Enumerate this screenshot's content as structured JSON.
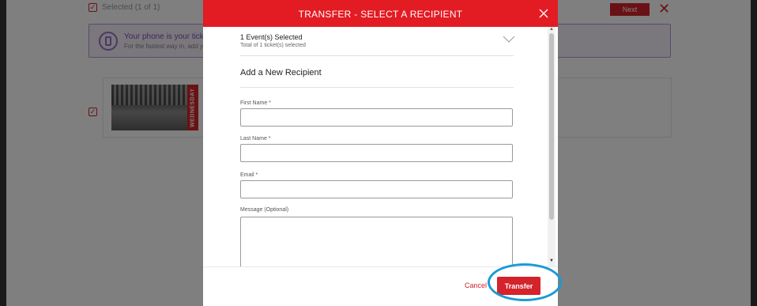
{
  "background": {
    "selected_text": "Selected (1 of 1)",
    "next_label": "Next",
    "banner": {
      "title": "Your phone is your ticket.",
      "subtitle": "For the fastest way in, add your"
    },
    "event_tag": "WEDNESDAY"
  },
  "modal": {
    "title": "TRANSFER - SELECT A RECIPIENT",
    "selection": {
      "title": "1 Event(s) Selected",
      "subtitle": "Total of 1 ticket(s) selected"
    },
    "section_title": "Add a New Recipient",
    "fields": {
      "first_name": {
        "label": "First Name *",
        "value": ""
      },
      "last_name": {
        "label": "Last Name *",
        "value": ""
      },
      "email": {
        "label": "Email *",
        "value": ""
      },
      "message": {
        "label": "Message (Optional)",
        "value": ""
      }
    },
    "footer": {
      "cancel_label": "Cancel",
      "transfer_label": "Transfer"
    }
  },
  "colors": {
    "accent_red": "#e31b23",
    "button_red": "#d4232b",
    "highlight_blue": "#1a9ad6",
    "banner_purple": "#b894dc"
  },
  "icons": [
    "close-icon",
    "chevron-down-icon",
    "checkbox-icon",
    "phone-icon"
  ]
}
